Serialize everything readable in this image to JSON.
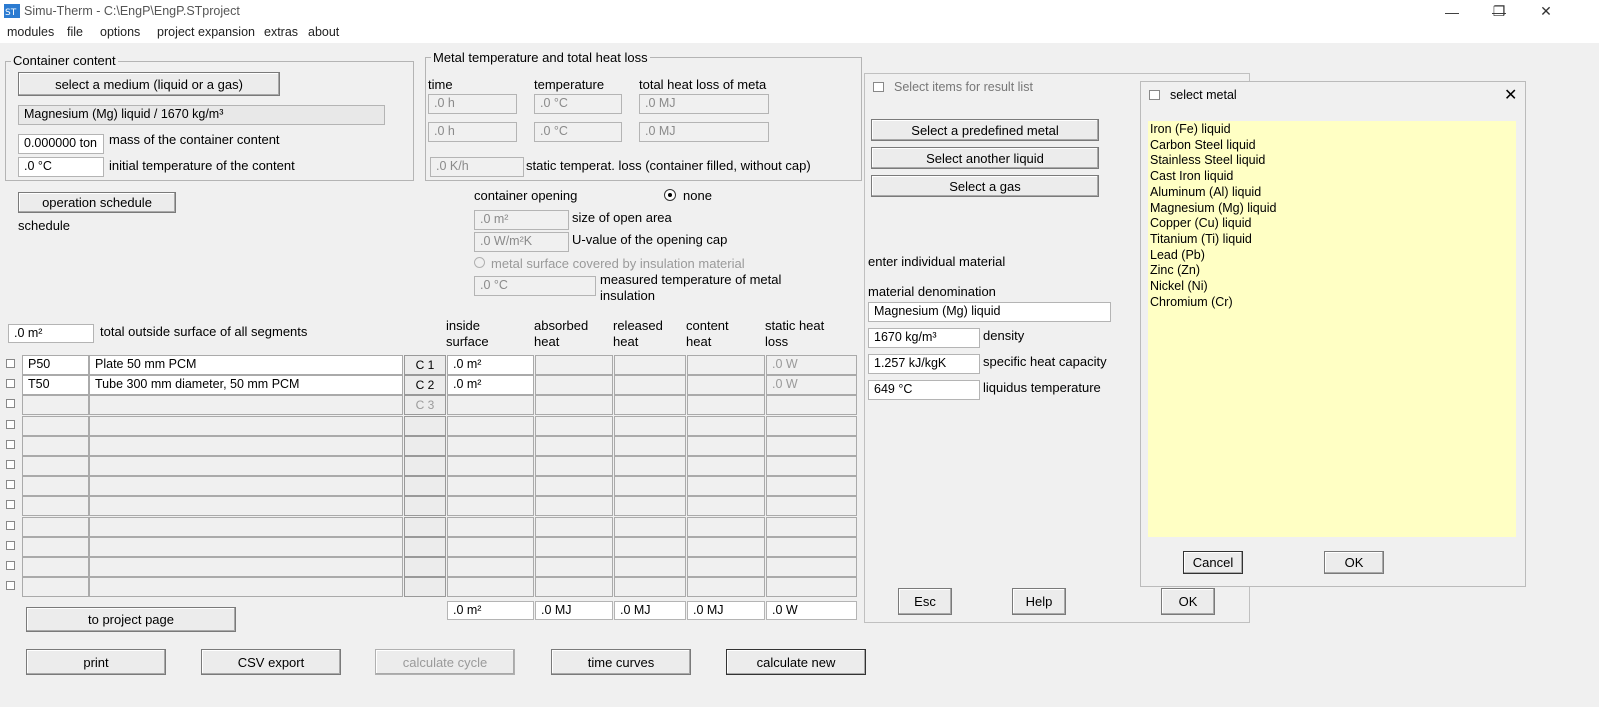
{
  "window": {
    "title": "Simu-Therm - C:\\EngP\\EngP.STproject",
    "minimize": "—",
    "maximize": "❐",
    "close": "✕"
  },
  "menu": [
    "modules",
    "file",
    "options",
    "project expansion",
    "extras",
    "about"
  ],
  "container": {
    "group_label": "Container content",
    "select_medium": "select a medium (liquid or a gas)",
    "medium_value": "Magnesium (Mg) liquid / 1670 kg/m³",
    "mass_value": "0.000000 ton",
    "mass_label": "mass of the container content",
    "temp_value": ".0 °C",
    "temp_label": "initial temperature of the content"
  },
  "metal_temp": {
    "group_label": "Metal temperature and total heat loss",
    "col_time": "time",
    "col_temperature": "temperature",
    "col_heatloss": "total heat loss of meta",
    "row1": {
      "time": ".0 h",
      "temp": ".0 °C",
      "loss": ".0 MJ"
    },
    "row2": {
      "time": ".0 h",
      "temp": ".0 °C",
      "loss": ".0 MJ"
    },
    "static_value": ".0 K/h",
    "static_label": "static temperat. loss (container filled, without cap)"
  },
  "schedule": {
    "button": "operation schedule",
    "label": "schedule"
  },
  "opening": {
    "label": "container opening",
    "radio_none": "none",
    "area_value": ".0 m²",
    "area_label": "size of open area",
    "uvalue_value": ".0 W/m²K",
    "uvalue_label": "U-value of the opening cap",
    "insulation_label": "metal surface covered by insulation material",
    "measured_value": ".0 °C",
    "measured_label": "measured temperature of metal insulation"
  },
  "surface": {
    "value": ".0 m²",
    "label": "total outside surface of all segments"
  },
  "table": {
    "headers": {
      "inside": "inside surface",
      "absorbed": "absorbed heat",
      "released": "released heat",
      "content": "content heat",
      "static": "static heat loss"
    },
    "rows": [
      {
        "code": "P50",
        "name": "Plate 50 mm PCM",
        "btn": "C 1",
        "inside": ".0 m²",
        "static": ".0 W"
      },
      {
        "code": "T50",
        "name": "Tube 300 mm diameter, 50 mm PCM",
        "btn": "C 2",
        "inside": ".0 m²",
        "static": ".0 W"
      },
      {
        "code": "",
        "name": "",
        "btn": "C 3",
        "inside": "",
        "static": ""
      },
      {
        "code": "",
        "name": "",
        "btn": "",
        "inside": "",
        "static": ""
      },
      {
        "code": "",
        "name": "",
        "btn": "",
        "inside": "",
        "static": ""
      },
      {
        "code": "",
        "name": "",
        "btn": "",
        "inside": "",
        "static": ""
      },
      {
        "code": "",
        "name": "",
        "btn": "",
        "inside": "",
        "static": ""
      },
      {
        "code": "",
        "name": "",
        "btn": "",
        "inside": "",
        "static": ""
      },
      {
        "code": "",
        "name": "",
        "btn": "",
        "inside": "",
        "static": ""
      },
      {
        "code": "",
        "name": "",
        "btn": "",
        "inside": "",
        "static": ""
      },
      {
        "code": "",
        "name": "",
        "btn": "",
        "inside": "",
        "static": ""
      },
      {
        "code": "",
        "name": "",
        "btn": "",
        "inside": "",
        "static": ""
      }
    ],
    "totals": {
      "inside": ".0 m²",
      "absorbed": ".0 MJ",
      "released": ".0 MJ",
      "content": ".0 MJ",
      "static": ".0 W"
    }
  },
  "bottom": {
    "project_page": "to project page",
    "print": "print",
    "csv": "CSV export",
    "calc_cycle": "calculate cycle",
    "time_curves": "time curves",
    "calc_new": "calculate new"
  },
  "result_dialog": {
    "title": "Select items for result list",
    "predefined": "Select a predefined metal",
    "another_liquid": "Select another liquid",
    "gas": "Select a gas",
    "individual": "enter individual material",
    "denom_label": "material denomination",
    "denom_value": "Magnesium (Mg) liquid",
    "density_value": "1670 kg/m³",
    "density_label": "density",
    "heatcap_value": "1.257 kJ/kgK",
    "heatcap_label": "specific heat capacity",
    "liquidus_value": "649 °C",
    "liquidus_label": "liquidus temperature",
    "esc": "Esc",
    "help": "Help",
    "ok": "OK"
  },
  "metal_dialog": {
    "title": "select metal",
    "close": "✕",
    "items": [
      "Iron (Fe) liquid",
      "Carbon Steel liquid",
      "Stainless Steel liquid",
      "Cast Iron liquid",
      "Aluminum (Al) liquid",
      "Magnesium (Mg) liquid",
      "Copper (Cu) liquid",
      "Titanium (Ti) liquid",
      "Lead (Pb)",
      "Zinc (Zn)",
      "Nickel (Ni)",
      "Chromium (Cr)"
    ],
    "cancel": "Cancel",
    "ok": "OK"
  },
  "colors": {
    "list_background": "#ffffc4",
    "window_background": "#f0f0f0"
  }
}
